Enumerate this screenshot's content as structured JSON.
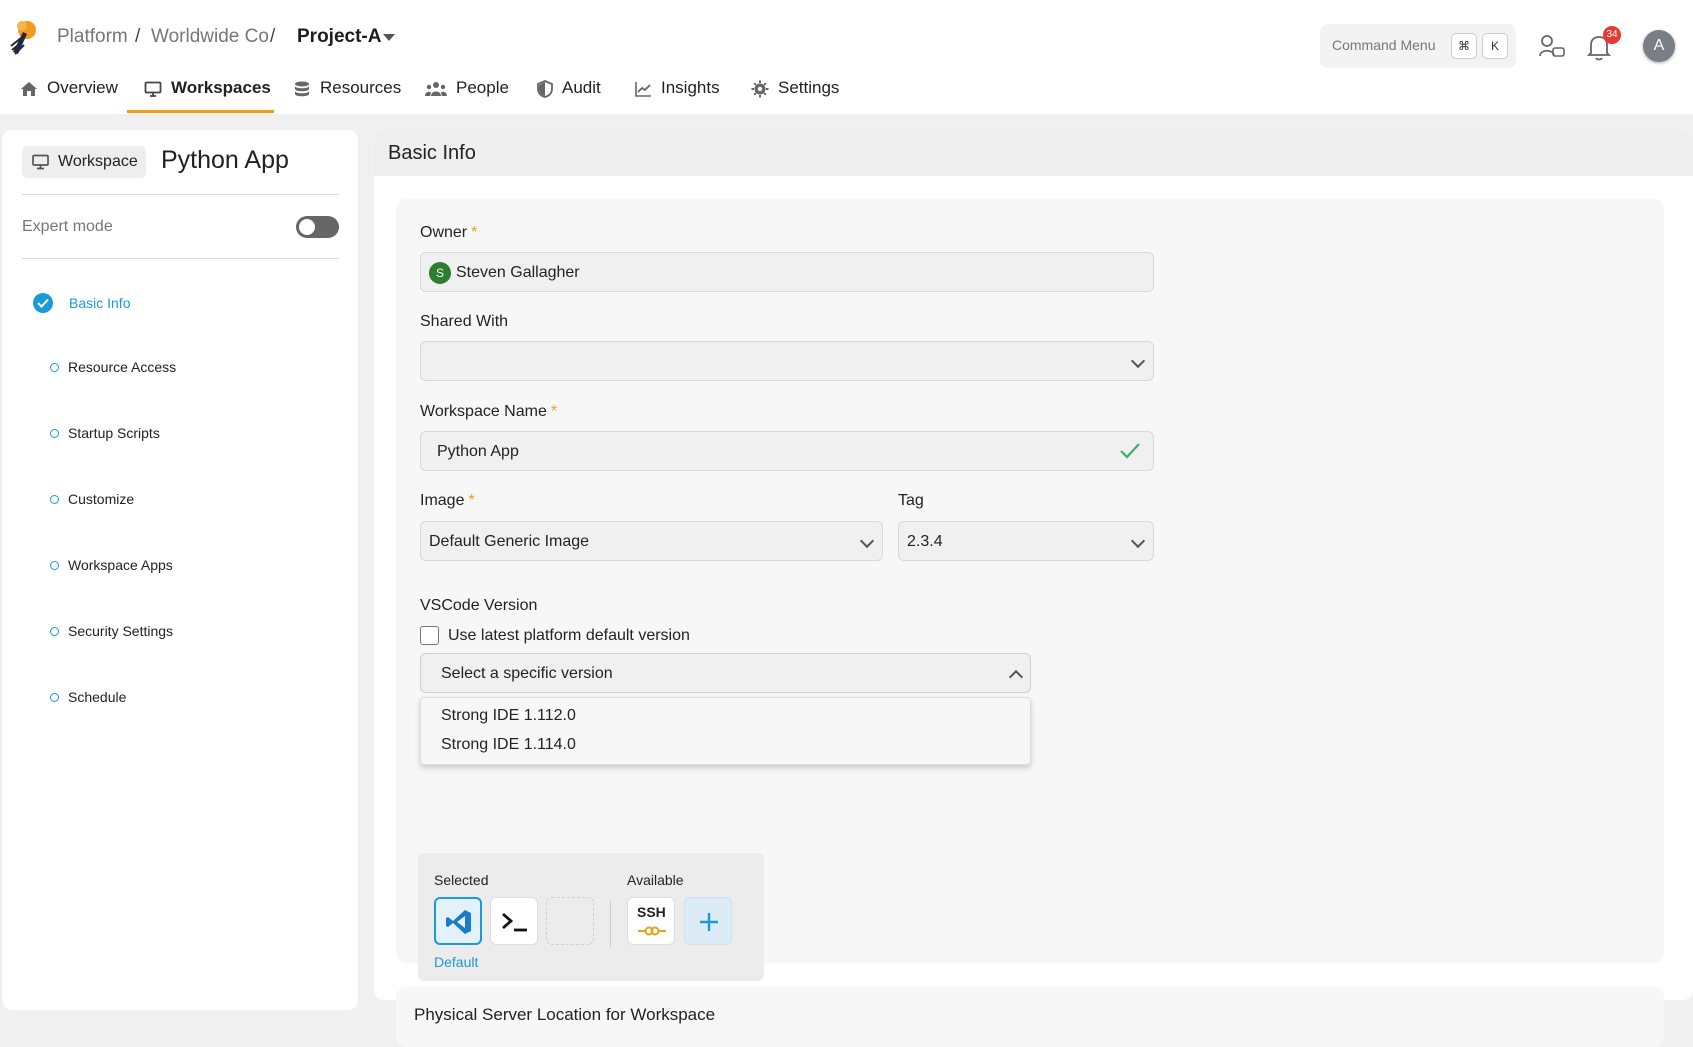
{
  "header": {
    "breadcrumb": [
      "Platform",
      "Worldwide Co"
    ],
    "separator": "/",
    "project": "Project-A",
    "command_menu": {
      "label": "Command Menu",
      "keys": [
        "⌘",
        "K"
      ]
    },
    "notification_count": "34",
    "avatar_initial": "A"
  },
  "tabs": [
    {
      "label": "Overview",
      "icon": "home-icon"
    },
    {
      "label": "Workspaces",
      "icon": "monitor-icon",
      "active": true
    },
    {
      "label": "Resources",
      "icon": "database-icon"
    },
    {
      "label": "People",
      "icon": "people-icon"
    },
    {
      "label": "Audit",
      "icon": "shield-icon"
    },
    {
      "label": "Insights",
      "icon": "chart-icon"
    },
    {
      "label": "Settings",
      "icon": "gear-icon"
    }
  ],
  "sidebar": {
    "chip_label": "Workspace",
    "title": "Python App",
    "expert_mode_label": "Expert mode",
    "expert_mode_on": false,
    "steps": [
      {
        "label": "Basic Info",
        "state": "complete"
      },
      {
        "label": "Resource Access",
        "state": "pending"
      },
      {
        "label": "Startup Scripts",
        "state": "pending"
      },
      {
        "label": "Customize",
        "state": "pending"
      },
      {
        "label": "Workspace Apps",
        "state": "pending"
      },
      {
        "label": "Security Settings",
        "state": "pending"
      },
      {
        "label": "Schedule",
        "state": "pending"
      }
    ]
  },
  "main": {
    "section_title": "Basic Info",
    "owner": {
      "label": "Owner",
      "required": "*",
      "value": "Steven Gallagher",
      "avatar_initial": "S"
    },
    "shared_with": {
      "label": "Shared With",
      "value": ""
    },
    "workspace_name": {
      "label": "Workspace Name",
      "required": "*",
      "value": "Python App"
    },
    "image": {
      "label": "Image",
      "required": "*",
      "value": "Default Generic Image"
    },
    "tag": {
      "label": "Tag",
      "value": "2.3.4"
    },
    "vscode": {
      "label": "VSCode Version",
      "checkbox_label": "Use latest platform default version",
      "checkbox_checked": false,
      "select_value": "Select a specific version",
      "options": [
        "Strong IDE 1.112.0",
        "Strong IDE 1.114.0"
      ]
    },
    "apps": {
      "selected_label": "Selected",
      "available_label": "Available",
      "default_label": "Default",
      "ssh_label": "SSH"
    },
    "next_section_title": "Physical Server Location for Workspace"
  },
  "colors": {
    "accent": "#f39a1f",
    "primary": "#1a9bd7",
    "badge": "#e53935",
    "owner_avatar": "#2e7d32"
  }
}
